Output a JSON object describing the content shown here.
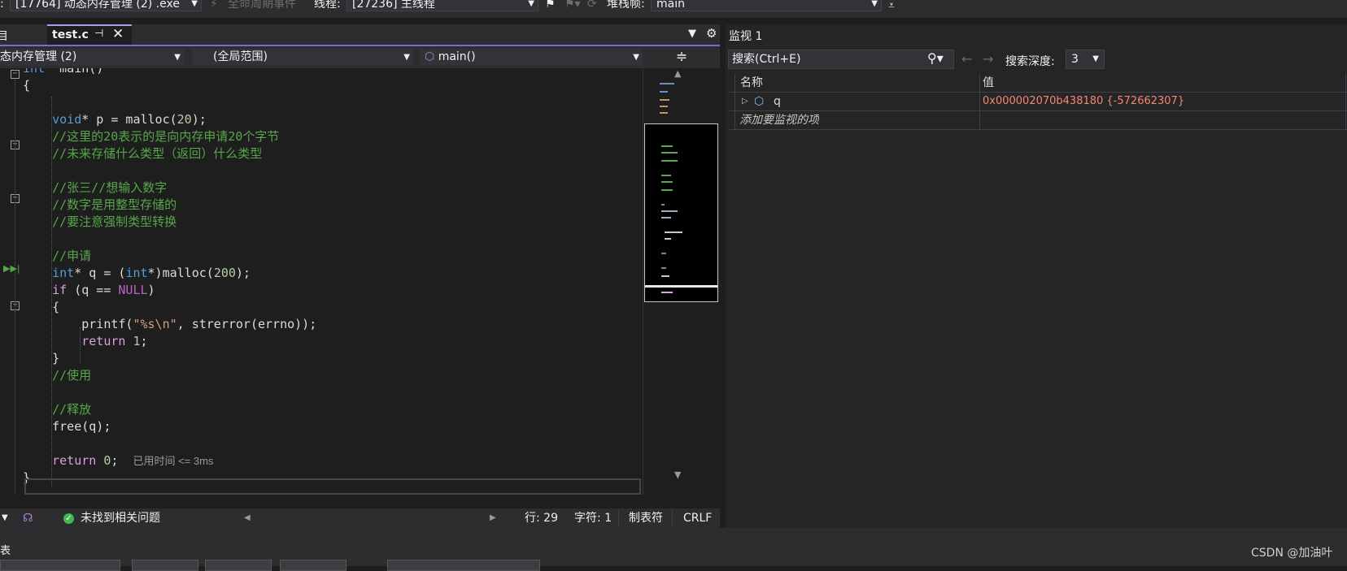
{
  "toolbar": {
    "process_label": ":",
    "process_value": "[17764] 动态内存管理 (2) .exe",
    "lifecycle_events": "全命周期事件",
    "thread_label": "线程:",
    "thread_value": "[27236] 主线程",
    "stackframe_label": "堆栈帧:",
    "stackframe_value": "main"
  },
  "tabs": {
    "active_label": "test.c",
    "prev_label": "目"
  },
  "navbar": {
    "project": "态内存管理 (2)",
    "scope": "(全局范围)",
    "function": "main()"
  },
  "code": {
    "lines": [
      {
        "row": 0,
        "parts": [
          [
            "kw",
            "int"
          ],
          [
            "",
            "  main()"
          ]
        ]
      },
      {
        "row": 1,
        "parts": [
          [
            "",
            "{"
          ]
        ]
      },
      {
        "row": 3,
        "parts": [
          [
            "",
            "    "
          ],
          [
            "kw",
            "void"
          ],
          [
            "",
            "* p = malloc("
          ],
          [
            "num",
            "20"
          ],
          [
            "",
            ");"
          ]
        ]
      },
      {
        "row": 4,
        "parts": [
          [
            "",
            "    "
          ],
          [
            "cm",
            "//这里的20表示的是向内存申请20个字节"
          ]
        ]
      },
      {
        "row": 5,
        "parts": [
          [
            "",
            "    "
          ],
          [
            "cm",
            "//未来存储什么类型（返回）什么类型"
          ]
        ]
      },
      {
        "row": 7,
        "parts": [
          [
            "",
            "    "
          ],
          [
            "cm",
            "//张三//想输入数字"
          ]
        ]
      },
      {
        "row": 8,
        "parts": [
          [
            "",
            "    "
          ],
          [
            "cm",
            "//数字是用整型存储的"
          ]
        ]
      },
      {
        "row": 9,
        "parts": [
          [
            "",
            "    "
          ],
          [
            "cm",
            "//要注意强制类型转换"
          ]
        ]
      },
      {
        "row": 11,
        "parts": [
          [
            "",
            "    "
          ],
          [
            "cm",
            "//申请"
          ]
        ]
      },
      {
        "row": 12,
        "parts": [
          [
            "",
            "    "
          ],
          [
            "kw",
            "int"
          ],
          [
            "",
            "* q = ("
          ],
          [
            "kw",
            "int"
          ],
          [
            "",
            "*)malloc("
          ],
          [
            "num",
            "200"
          ],
          [
            "",
            ");"
          ]
        ]
      },
      {
        "row": 13,
        "parts": [
          [
            "",
            "    "
          ],
          [
            "ctl",
            "if"
          ],
          [
            "",
            " (q == "
          ],
          [
            "mac",
            "NULL"
          ],
          [
            "",
            ")"
          ]
        ]
      },
      {
        "row": 14,
        "parts": [
          [
            "",
            "    {"
          ]
        ]
      },
      {
        "row": 15,
        "parts": [
          [
            "",
            "        printf("
          ],
          [
            "str",
            "\"%s\\n\""
          ],
          [
            "",
            ", strerror(errno));"
          ]
        ]
      },
      {
        "row": 16,
        "parts": [
          [
            "",
            "        "
          ],
          [
            "ctl",
            "return"
          ],
          [
            "",
            " "
          ],
          [
            "num",
            "1"
          ],
          [
            "",
            ";"
          ]
        ]
      },
      {
        "row": 17,
        "parts": [
          [
            "",
            "    }"
          ]
        ]
      },
      {
        "row": 18,
        "parts": [
          [
            "",
            "    "
          ],
          [
            "cm",
            "//使用"
          ]
        ]
      },
      {
        "row": 20,
        "parts": [
          [
            "",
            "    "
          ],
          [
            "cm",
            "//释放"
          ]
        ]
      },
      {
        "row": 21,
        "parts": [
          [
            "",
            "    free(q);"
          ]
        ]
      },
      {
        "row": 23,
        "parts": [
          [
            "",
            "    "
          ],
          [
            "ctl",
            "return"
          ],
          [
            "",
            " "
          ],
          [
            "num",
            "0"
          ],
          [
            "",
            ";  "
          ]
        ]
      },
      {
        "row": 24,
        "parts": [
          [
            "",
            "}"
          ]
        ]
      }
    ],
    "elapsed_hint": "已用时间 <= 3ms"
  },
  "editor_status": {
    "issues": "未找到相关问题",
    "line": "行: 29",
    "char": "字符: 1",
    "tabs_mode": "制表符",
    "eol": "CRLF"
  },
  "watch": {
    "title": "监视 1",
    "search_placeholder": "搜索(Ctrl+E)",
    "depth_label": "搜索深度:",
    "depth_value": "3",
    "col_name": "名称",
    "col_value": "值",
    "rows": [
      {
        "name": "q",
        "value": "0x000002070b438180 {-572662307}"
      }
    ],
    "add_item": "添加要监视的项"
  },
  "bottom": {
    "title": "表",
    "watermark": "CSDN @加油叶"
  },
  "colors": {
    "value_red": "#f48771",
    "accent": "#7b69d8"
  }
}
